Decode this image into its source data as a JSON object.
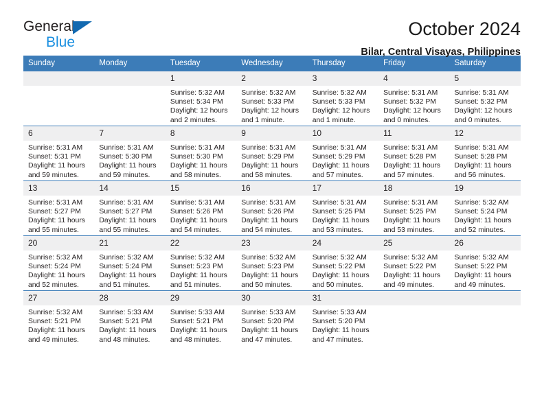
{
  "brand": {
    "name_top": "General",
    "name_bottom": "Blue",
    "triangle_color": "#1269b0",
    "blue_text_color": "#1a8fe0"
  },
  "header": {
    "title": "October 2024",
    "subtitle": "Bilar, Central Visayas, Philippines"
  },
  "theme": {
    "header_row_bg": "#3c7cb8",
    "header_row_text": "#ffffff",
    "daynum_bg": "#efeff0",
    "row_border": "#3c7cb8"
  },
  "calendar": {
    "weekday_headers": [
      "Sunday",
      "Monday",
      "Tuesday",
      "Wednesday",
      "Thursday",
      "Friday",
      "Saturday"
    ],
    "weeks": [
      [
        {
          "day": "",
          "sunrise": "",
          "sunset": "",
          "daylight": ""
        },
        {
          "day": "",
          "sunrise": "",
          "sunset": "",
          "daylight": ""
        },
        {
          "day": "1",
          "sunrise": "Sunrise: 5:32 AM",
          "sunset": "Sunset: 5:34 PM",
          "daylight": "Daylight: 12 hours and 2 minutes."
        },
        {
          "day": "2",
          "sunrise": "Sunrise: 5:32 AM",
          "sunset": "Sunset: 5:33 PM",
          "daylight": "Daylight: 12 hours and 1 minute."
        },
        {
          "day": "3",
          "sunrise": "Sunrise: 5:32 AM",
          "sunset": "Sunset: 5:33 PM",
          "daylight": "Daylight: 12 hours and 1 minute."
        },
        {
          "day": "4",
          "sunrise": "Sunrise: 5:31 AM",
          "sunset": "Sunset: 5:32 PM",
          "daylight": "Daylight: 12 hours and 0 minutes."
        },
        {
          "day": "5",
          "sunrise": "Sunrise: 5:31 AM",
          "sunset": "Sunset: 5:32 PM",
          "daylight": "Daylight: 12 hours and 0 minutes."
        }
      ],
      [
        {
          "day": "6",
          "sunrise": "Sunrise: 5:31 AM",
          "sunset": "Sunset: 5:31 PM",
          "daylight": "Daylight: 11 hours and 59 minutes."
        },
        {
          "day": "7",
          "sunrise": "Sunrise: 5:31 AM",
          "sunset": "Sunset: 5:30 PM",
          "daylight": "Daylight: 11 hours and 59 minutes."
        },
        {
          "day": "8",
          "sunrise": "Sunrise: 5:31 AM",
          "sunset": "Sunset: 5:30 PM",
          "daylight": "Daylight: 11 hours and 58 minutes."
        },
        {
          "day": "9",
          "sunrise": "Sunrise: 5:31 AM",
          "sunset": "Sunset: 5:29 PM",
          "daylight": "Daylight: 11 hours and 58 minutes."
        },
        {
          "day": "10",
          "sunrise": "Sunrise: 5:31 AM",
          "sunset": "Sunset: 5:29 PM",
          "daylight": "Daylight: 11 hours and 57 minutes."
        },
        {
          "day": "11",
          "sunrise": "Sunrise: 5:31 AM",
          "sunset": "Sunset: 5:28 PM",
          "daylight": "Daylight: 11 hours and 57 minutes."
        },
        {
          "day": "12",
          "sunrise": "Sunrise: 5:31 AM",
          "sunset": "Sunset: 5:28 PM",
          "daylight": "Daylight: 11 hours and 56 minutes."
        }
      ],
      [
        {
          "day": "13",
          "sunrise": "Sunrise: 5:31 AM",
          "sunset": "Sunset: 5:27 PM",
          "daylight": "Daylight: 11 hours and 55 minutes."
        },
        {
          "day": "14",
          "sunrise": "Sunrise: 5:31 AM",
          "sunset": "Sunset: 5:27 PM",
          "daylight": "Daylight: 11 hours and 55 minutes."
        },
        {
          "day": "15",
          "sunrise": "Sunrise: 5:31 AM",
          "sunset": "Sunset: 5:26 PM",
          "daylight": "Daylight: 11 hours and 54 minutes."
        },
        {
          "day": "16",
          "sunrise": "Sunrise: 5:31 AM",
          "sunset": "Sunset: 5:26 PM",
          "daylight": "Daylight: 11 hours and 54 minutes."
        },
        {
          "day": "17",
          "sunrise": "Sunrise: 5:31 AM",
          "sunset": "Sunset: 5:25 PM",
          "daylight": "Daylight: 11 hours and 53 minutes."
        },
        {
          "day": "18",
          "sunrise": "Sunrise: 5:31 AM",
          "sunset": "Sunset: 5:25 PM",
          "daylight": "Daylight: 11 hours and 53 minutes."
        },
        {
          "day": "19",
          "sunrise": "Sunrise: 5:32 AM",
          "sunset": "Sunset: 5:24 PM",
          "daylight": "Daylight: 11 hours and 52 minutes."
        }
      ],
      [
        {
          "day": "20",
          "sunrise": "Sunrise: 5:32 AM",
          "sunset": "Sunset: 5:24 PM",
          "daylight": "Daylight: 11 hours and 52 minutes."
        },
        {
          "day": "21",
          "sunrise": "Sunrise: 5:32 AM",
          "sunset": "Sunset: 5:24 PM",
          "daylight": "Daylight: 11 hours and 51 minutes."
        },
        {
          "day": "22",
          "sunrise": "Sunrise: 5:32 AM",
          "sunset": "Sunset: 5:23 PM",
          "daylight": "Daylight: 11 hours and 51 minutes."
        },
        {
          "day": "23",
          "sunrise": "Sunrise: 5:32 AM",
          "sunset": "Sunset: 5:23 PM",
          "daylight": "Daylight: 11 hours and 50 minutes."
        },
        {
          "day": "24",
          "sunrise": "Sunrise: 5:32 AM",
          "sunset": "Sunset: 5:22 PM",
          "daylight": "Daylight: 11 hours and 50 minutes."
        },
        {
          "day": "25",
          "sunrise": "Sunrise: 5:32 AM",
          "sunset": "Sunset: 5:22 PM",
          "daylight": "Daylight: 11 hours and 49 minutes."
        },
        {
          "day": "26",
          "sunrise": "Sunrise: 5:32 AM",
          "sunset": "Sunset: 5:22 PM",
          "daylight": "Daylight: 11 hours and 49 minutes."
        }
      ],
      [
        {
          "day": "27",
          "sunrise": "Sunrise: 5:32 AM",
          "sunset": "Sunset: 5:21 PM",
          "daylight": "Daylight: 11 hours and 49 minutes."
        },
        {
          "day": "28",
          "sunrise": "Sunrise: 5:33 AM",
          "sunset": "Sunset: 5:21 PM",
          "daylight": "Daylight: 11 hours and 48 minutes."
        },
        {
          "day": "29",
          "sunrise": "Sunrise: 5:33 AM",
          "sunset": "Sunset: 5:21 PM",
          "daylight": "Daylight: 11 hours and 48 minutes."
        },
        {
          "day": "30",
          "sunrise": "Sunrise: 5:33 AM",
          "sunset": "Sunset: 5:20 PM",
          "daylight": "Daylight: 11 hours and 47 minutes."
        },
        {
          "day": "31",
          "sunrise": "Sunrise: 5:33 AM",
          "sunset": "Sunset: 5:20 PM",
          "daylight": "Daylight: 11 hours and 47 minutes."
        },
        {
          "day": "",
          "sunrise": "",
          "sunset": "",
          "daylight": ""
        },
        {
          "day": "",
          "sunrise": "",
          "sunset": "",
          "daylight": ""
        }
      ]
    ]
  }
}
